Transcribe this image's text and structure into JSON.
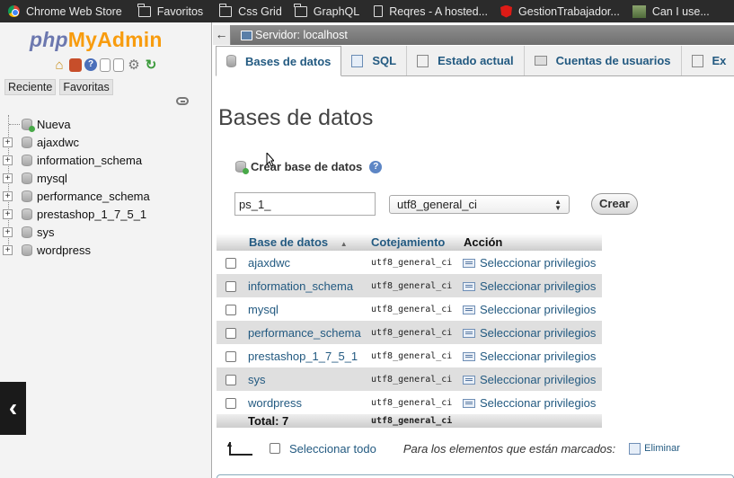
{
  "bookmarks": [
    {
      "label": "Chrome Web Store",
      "icon": "chrome-store-icon"
    },
    {
      "label": "Favoritos",
      "icon": "folder-icon"
    },
    {
      "label": "Css Grid",
      "icon": "folder-icon"
    },
    {
      "label": "GraphQL",
      "icon": "folder-icon"
    },
    {
      "label": "Reqres - A hosted...",
      "icon": "document-icon"
    },
    {
      "label": "GestionTrabajador...",
      "icon": "angular-icon"
    },
    {
      "label": "Can I use...",
      "icon": "photo-icon"
    }
  ],
  "sidebar": {
    "logo_php": "php",
    "logo_admin": "MyAdmin",
    "tabs": [
      {
        "label": "Reciente"
      },
      {
        "label": "Favoritas"
      }
    ],
    "tree": [
      {
        "label": "Nueva"
      },
      {
        "label": "ajaxdwc"
      },
      {
        "label": "information_schema"
      },
      {
        "label": "mysql"
      },
      {
        "label": "performance_schema"
      },
      {
        "label": "prestashop_1_7_5_1"
      },
      {
        "label": "sys"
      },
      {
        "label": "wordpress"
      }
    ]
  },
  "server_bar": {
    "label": "Servidor: localhost"
  },
  "main_tabs": [
    {
      "label": "Bases de datos",
      "icon": "database-icon"
    },
    {
      "label": "SQL",
      "icon": "sql-icon"
    },
    {
      "label": "Estado actual",
      "icon": "status-icon"
    },
    {
      "label": "Cuentas de usuarios",
      "icon": "users-icon"
    },
    {
      "label": "Ex",
      "icon": "export-icon"
    }
  ],
  "page": {
    "title": "Bases de datos",
    "create_label": "Crear base de datos",
    "db_name_value": "ps_1_",
    "collation_value": "utf8_general_ci",
    "create_button": "Crear"
  },
  "table": {
    "headers": [
      "Base de datos",
      "Cotejamiento",
      "Acción"
    ],
    "rows": [
      {
        "name": "ajaxdwc",
        "collation": "utf8_general_ci",
        "action": "Seleccionar privilegios"
      },
      {
        "name": "information_schema",
        "collation": "utf8_general_ci",
        "action": "Seleccionar privilegios"
      },
      {
        "name": "mysql",
        "collation": "utf8_general_ci",
        "action": "Seleccionar privilegios"
      },
      {
        "name": "performance_schema",
        "collation": "utf8_general_ci",
        "action": "Seleccionar privilegios"
      },
      {
        "name": "prestashop_1_7_5_1",
        "collation": "utf8_general_ci",
        "action": "Seleccionar privilegios"
      },
      {
        "name": "sys",
        "collation": "utf8_general_ci",
        "action": "Seleccionar privilegios"
      },
      {
        "name": "wordpress",
        "collation": "utf8_general_ci",
        "action": "Seleccionar privilegios"
      }
    ],
    "total_label": "Total: 7",
    "total_collation": "utf8_general_ci"
  },
  "bottom": {
    "select_all": "Seleccionar todo",
    "marked_text": "Para los elementos que están marcados:",
    "delete_label": "Eliminar"
  },
  "colors": {
    "link": "#235a81",
    "logo_php": "#6c78af",
    "logo_admin": "#f89c0e"
  }
}
